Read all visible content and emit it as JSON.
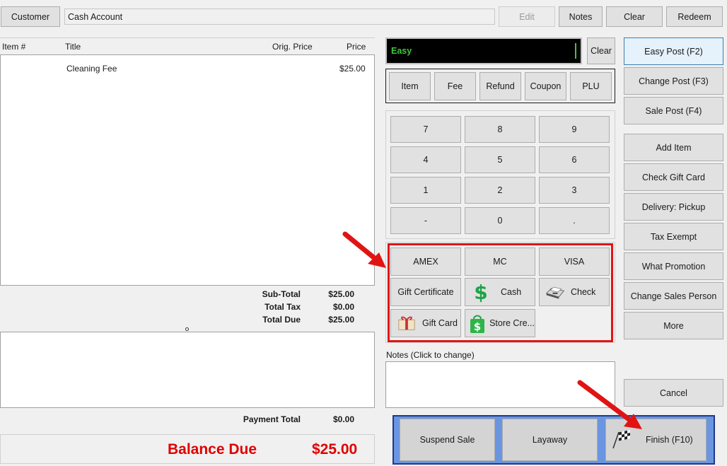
{
  "topbar": {
    "customer_button": "Customer",
    "account_field": "Cash Account",
    "edit_button": "Edit",
    "notes_button": "Notes",
    "clear_button": "Clear",
    "redeem_button": "Redeem"
  },
  "items_table": {
    "headers": {
      "item_no": "Item #",
      "title": "Title",
      "orig_price": "Orig. Price",
      "price": "Price"
    },
    "rows": [
      {
        "item_no": "",
        "title": "Cleaning Fee",
        "orig_price": "",
        "price": "$25.00"
      }
    ]
  },
  "totals": {
    "subtotal_label": "Sub-Total",
    "subtotal_value": "$25.00",
    "tax_label": "Total Tax",
    "tax_value": "$0.00",
    "due_label": "Total Due",
    "due_value": "$25.00",
    "payment_total_label": "Payment Total",
    "payment_total_value": "$0.00",
    "balance_due_label": "Balance Due",
    "balance_due_value": "$25.00"
  },
  "entry": {
    "mode_text": "Easy",
    "clear_button": "Clear",
    "mode_buttons": [
      "Item",
      "Fee",
      "Refund",
      "Coupon",
      "PLU"
    ]
  },
  "keypad": [
    "7",
    "8",
    "9",
    "4",
    "5",
    "6",
    "1",
    "2",
    "3",
    "-",
    "0",
    "."
  ],
  "payments": {
    "amex": "AMEX",
    "mc": "MC",
    "visa": "VISA",
    "gift_certificate": "Gift Certificate",
    "cash": "Cash",
    "check": "Check",
    "gift_card": "Gift Card",
    "store_credit": "Store Cre..."
  },
  "notes": {
    "label": "Notes (Click to change)"
  },
  "right_menu": {
    "easy_post": "Easy Post (F2)",
    "change_post": "Change Post (F3)",
    "sale_post": "Sale Post (F4)",
    "add_item": "Add Item",
    "check_gift_card": "Check Gift Card",
    "delivery": "Delivery: Pickup",
    "tax_exempt": "Tax Exempt",
    "what_promotion": "What Promotion",
    "change_sales_person": "Change Sales Person",
    "more": "More",
    "cancel": "Cancel"
  },
  "bottom_actions": {
    "suspend_sale": "Suspend Sale",
    "layaway": "Layaway",
    "finish": "Finish (F10)"
  },
  "colors": {
    "highlight_red": "#e11414",
    "balance_red": "#e00000",
    "entry_green": "#3cc83c",
    "blue_frame": "#6a95e0",
    "primary_blue": "#e5f1fb"
  }
}
